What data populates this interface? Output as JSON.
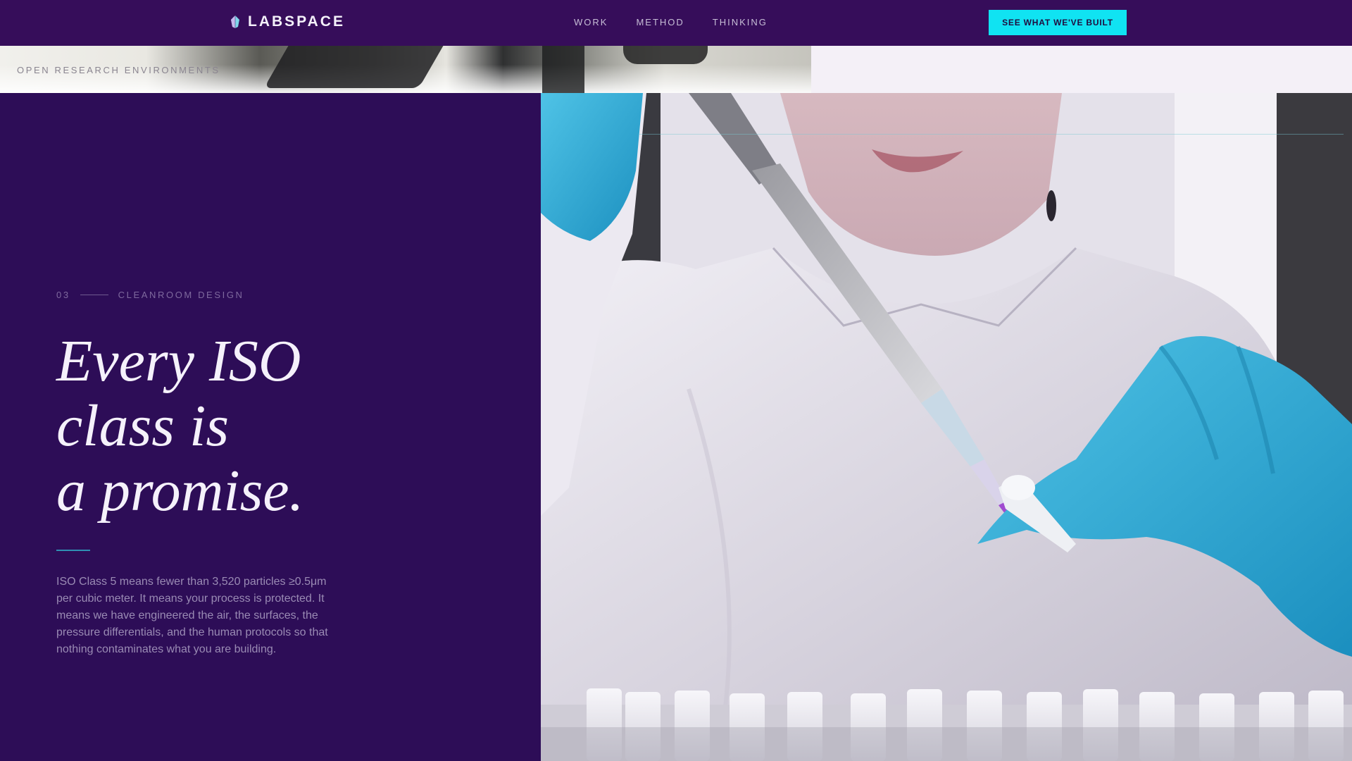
{
  "brand": {
    "name": "LABSPACE",
    "icon": "crystal-icon"
  },
  "nav": {
    "links": [
      "WORK",
      "METHOD",
      "THINKING"
    ],
    "cta_label": "SEE WHAT WE'VE BUILT"
  },
  "top_strip": {
    "label": "OPEN RESEARCH ENVIRONMENTS"
  },
  "section": {
    "number": "03",
    "category": "CLEANROOM DESIGN",
    "headline_lines": [
      "Every ISO",
      "class is",
      "a promise."
    ],
    "body": "ISO Class 5 means fewer than 3,520 particles ≥0.5μm per cubic meter. It means your process is protected. It means we have engineered the air, the surfaces, the pressure differentials, and the human protocols so that nothing contaminates what you are building."
  },
  "colors": {
    "nav_bg": "#360d5a",
    "panel_bg": "#2d0d57",
    "accent_cyan": "#10e3f2",
    "headline": "#f5f1fb",
    "body_text": "#9a8bb4"
  }
}
